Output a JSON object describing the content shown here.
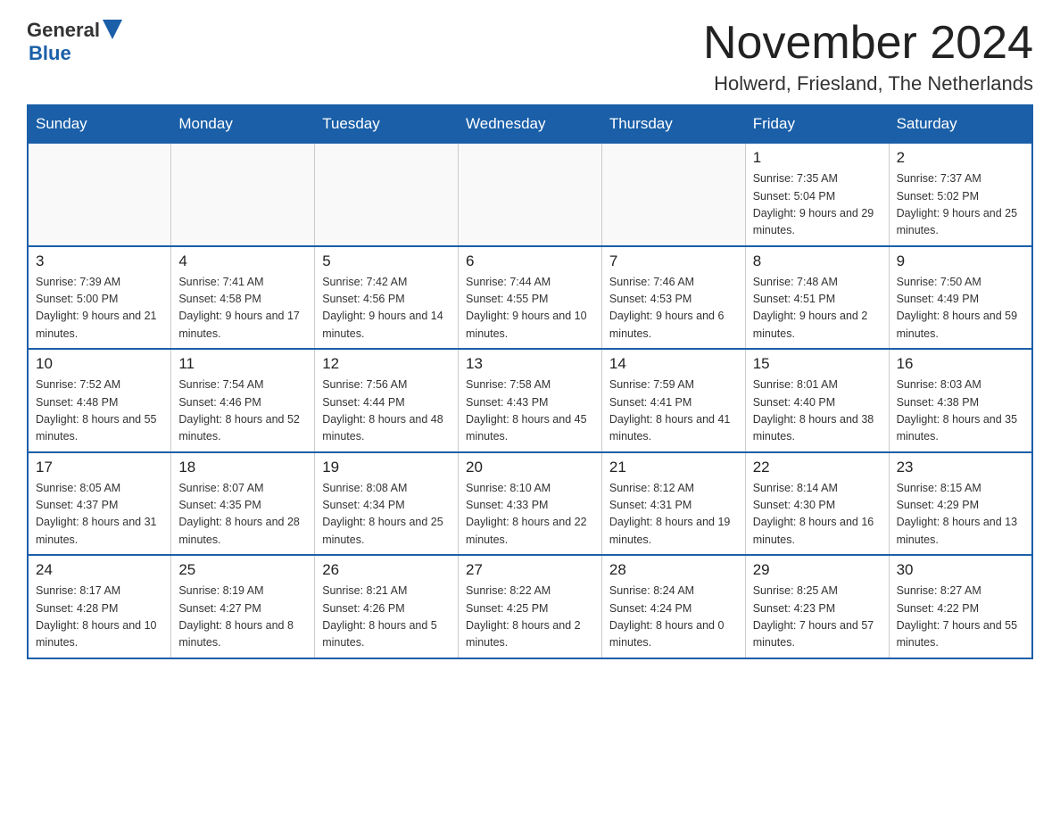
{
  "logo": {
    "general": "General",
    "blue": "Blue"
  },
  "header": {
    "month_year": "November 2024",
    "location": "Holwerd, Friesland, The Netherlands"
  },
  "weekdays": [
    "Sunday",
    "Monday",
    "Tuesday",
    "Wednesday",
    "Thursday",
    "Friday",
    "Saturday"
  ],
  "weeks": [
    [
      {
        "day": "",
        "info": ""
      },
      {
        "day": "",
        "info": ""
      },
      {
        "day": "",
        "info": ""
      },
      {
        "day": "",
        "info": ""
      },
      {
        "day": "",
        "info": ""
      },
      {
        "day": "1",
        "info": "Sunrise: 7:35 AM\nSunset: 5:04 PM\nDaylight: 9 hours and 29 minutes."
      },
      {
        "day": "2",
        "info": "Sunrise: 7:37 AM\nSunset: 5:02 PM\nDaylight: 9 hours and 25 minutes."
      }
    ],
    [
      {
        "day": "3",
        "info": "Sunrise: 7:39 AM\nSunset: 5:00 PM\nDaylight: 9 hours and 21 minutes."
      },
      {
        "day": "4",
        "info": "Sunrise: 7:41 AM\nSunset: 4:58 PM\nDaylight: 9 hours and 17 minutes."
      },
      {
        "day": "5",
        "info": "Sunrise: 7:42 AM\nSunset: 4:56 PM\nDaylight: 9 hours and 14 minutes."
      },
      {
        "day": "6",
        "info": "Sunrise: 7:44 AM\nSunset: 4:55 PM\nDaylight: 9 hours and 10 minutes."
      },
      {
        "day": "7",
        "info": "Sunrise: 7:46 AM\nSunset: 4:53 PM\nDaylight: 9 hours and 6 minutes."
      },
      {
        "day": "8",
        "info": "Sunrise: 7:48 AM\nSunset: 4:51 PM\nDaylight: 9 hours and 2 minutes."
      },
      {
        "day": "9",
        "info": "Sunrise: 7:50 AM\nSunset: 4:49 PM\nDaylight: 8 hours and 59 minutes."
      }
    ],
    [
      {
        "day": "10",
        "info": "Sunrise: 7:52 AM\nSunset: 4:48 PM\nDaylight: 8 hours and 55 minutes."
      },
      {
        "day": "11",
        "info": "Sunrise: 7:54 AM\nSunset: 4:46 PM\nDaylight: 8 hours and 52 minutes."
      },
      {
        "day": "12",
        "info": "Sunrise: 7:56 AM\nSunset: 4:44 PM\nDaylight: 8 hours and 48 minutes."
      },
      {
        "day": "13",
        "info": "Sunrise: 7:58 AM\nSunset: 4:43 PM\nDaylight: 8 hours and 45 minutes."
      },
      {
        "day": "14",
        "info": "Sunrise: 7:59 AM\nSunset: 4:41 PM\nDaylight: 8 hours and 41 minutes."
      },
      {
        "day": "15",
        "info": "Sunrise: 8:01 AM\nSunset: 4:40 PM\nDaylight: 8 hours and 38 minutes."
      },
      {
        "day": "16",
        "info": "Sunrise: 8:03 AM\nSunset: 4:38 PM\nDaylight: 8 hours and 35 minutes."
      }
    ],
    [
      {
        "day": "17",
        "info": "Sunrise: 8:05 AM\nSunset: 4:37 PM\nDaylight: 8 hours and 31 minutes."
      },
      {
        "day": "18",
        "info": "Sunrise: 8:07 AM\nSunset: 4:35 PM\nDaylight: 8 hours and 28 minutes."
      },
      {
        "day": "19",
        "info": "Sunrise: 8:08 AM\nSunset: 4:34 PM\nDaylight: 8 hours and 25 minutes."
      },
      {
        "day": "20",
        "info": "Sunrise: 8:10 AM\nSunset: 4:33 PM\nDaylight: 8 hours and 22 minutes."
      },
      {
        "day": "21",
        "info": "Sunrise: 8:12 AM\nSunset: 4:31 PM\nDaylight: 8 hours and 19 minutes."
      },
      {
        "day": "22",
        "info": "Sunrise: 8:14 AM\nSunset: 4:30 PM\nDaylight: 8 hours and 16 minutes."
      },
      {
        "day": "23",
        "info": "Sunrise: 8:15 AM\nSunset: 4:29 PM\nDaylight: 8 hours and 13 minutes."
      }
    ],
    [
      {
        "day": "24",
        "info": "Sunrise: 8:17 AM\nSunset: 4:28 PM\nDaylight: 8 hours and 10 minutes."
      },
      {
        "day": "25",
        "info": "Sunrise: 8:19 AM\nSunset: 4:27 PM\nDaylight: 8 hours and 8 minutes."
      },
      {
        "day": "26",
        "info": "Sunrise: 8:21 AM\nSunset: 4:26 PM\nDaylight: 8 hours and 5 minutes."
      },
      {
        "day": "27",
        "info": "Sunrise: 8:22 AM\nSunset: 4:25 PM\nDaylight: 8 hours and 2 minutes."
      },
      {
        "day": "28",
        "info": "Sunrise: 8:24 AM\nSunset: 4:24 PM\nDaylight: 8 hours and 0 minutes."
      },
      {
        "day": "29",
        "info": "Sunrise: 8:25 AM\nSunset: 4:23 PM\nDaylight: 7 hours and 57 minutes."
      },
      {
        "day": "30",
        "info": "Sunrise: 8:27 AM\nSunset: 4:22 PM\nDaylight: 7 hours and 55 minutes."
      }
    ]
  ]
}
